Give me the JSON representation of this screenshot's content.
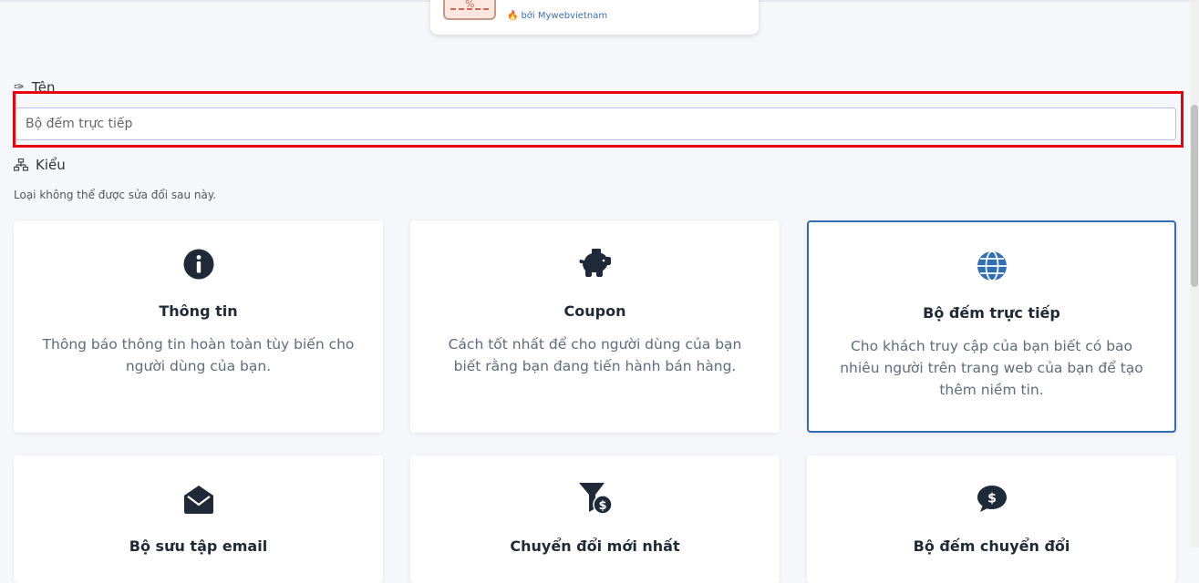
{
  "preview": {
    "badge_text": "%",
    "brand_text": "bởi Mywebvietnam"
  },
  "name_field": {
    "label": "Tên",
    "placeholder": "Bộ đếm trực tiếp"
  },
  "type_field": {
    "label": "Kiểu",
    "help_text": "Loại không thể được sửa đổi sau này."
  },
  "cards": [
    {
      "title": "Thông tin",
      "description": "Thông báo thông tin hoàn toàn tùy biến cho người dùng của bạn.",
      "icon": "info-icon",
      "selected": false
    },
    {
      "title": "Coupon",
      "description": "Cách tốt nhất để cho người dùng của bạn biết rằng bạn đang tiến hành bán hàng.",
      "icon": "piggy-bank-icon",
      "selected": false
    },
    {
      "title": "Bộ đếm trực tiếp",
      "description": "Cho khách truy cập của bạn biết có bao nhiêu người trên trang web của bạn để tạo thêm niềm tin.",
      "icon": "globe-icon",
      "selected": true
    },
    {
      "title": "Bộ sưu tập email",
      "description": "",
      "icon": "envelope-open-icon",
      "selected": false
    },
    {
      "title": "Chuyển đổi mới nhất",
      "description": "",
      "icon": "funnel-dollar-icon",
      "selected": false
    },
    {
      "title": "Bộ đếm chuyển đổi",
      "description": "",
      "icon": "comment-dollar-icon",
      "selected": false
    }
  ],
  "colors": {
    "highlight": "#e8000b",
    "selected_border": "#2f6eb5",
    "globe": "#2f6eb5",
    "icon_dark": "#1f2937"
  }
}
